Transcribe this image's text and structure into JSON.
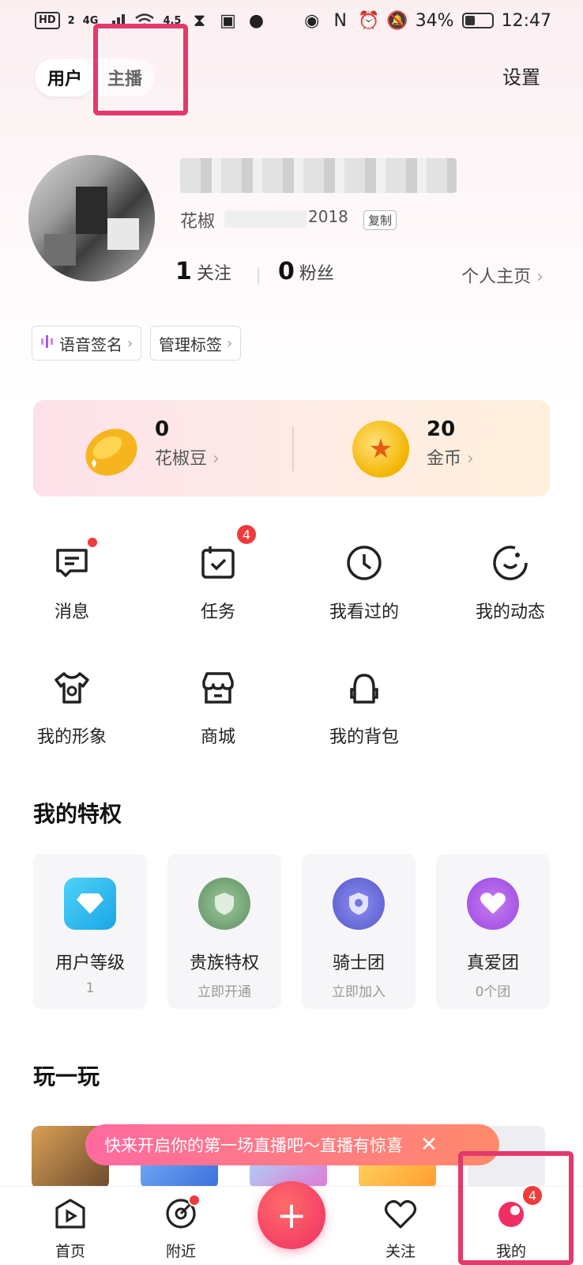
{
  "status_bar": {
    "hd": "HD",
    "sim": "2",
    "net": "4G",
    "speed": "4.5",
    "battery": "34%",
    "time": "12:47"
  },
  "header": {
    "tabs": [
      {
        "label": "用户",
        "active": true
      },
      {
        "label": "主播",
        "active": false
      }
    ],
    "settings_label": "设置"
  },
  "profile": {
    "id_prefix": "花椒",
    "id_suffix": "2018",
    "copy_label": "复制",
    "following_count": "1",
    "following_label": "关注",
    "fans_count": "0",
    "fans_label": "粉丝",
    "homepage_label": "个人主页"
  },
  "tags": {
    "voice_sign": "语音签名",
    "manage_tags": "管理标签"
  },
  "wallet": {
    "beans": {
      "value": "0",
      "label": "花椒豆"
    },
    "coins": {
      "value": "20",
      "label": "金币"
    }
  },
  "menu": {
    "messages": "消息",
    "tasks": "任务",
    "tasks_badge": "4",
    "history": "我看过的",
    "moments": "我的动态",
    "avatar_style": "我的形象",
    "mall": "商城",
    "backpack": "我的背包"
  },
  "privileges": {
    "title": "我的特权",
    "items": [
      {
        "label": "用户等级",
        "sub": "1"
      },
      {
        "label": "贵族特权",
        "sub": "立即开通"
      },
      {
        "label": "骑士团",
        "sub": "立即加入"
      },
      {
        "label": "真爱团",
        "sub": "0个团"
      }
    ]
  },
  "play": {
    "title": "玩一玩"
  },
  "promo": {
    "text": "快来开启你的第一场直播吧～直播有惊喜",
    "close": "✕"
  },
  "nav": {
    "home": "首页",
    "nearby": "附近",
    "add": "+",
    "follow": "关注",
    "mine": "我的",
    "mine_badge": "4"
  },
  "colors": {
    "accent": "#ef2f62",
    "badge": "#ef3b3b",
    "highlight_box": "#e3396b"
  }
}
